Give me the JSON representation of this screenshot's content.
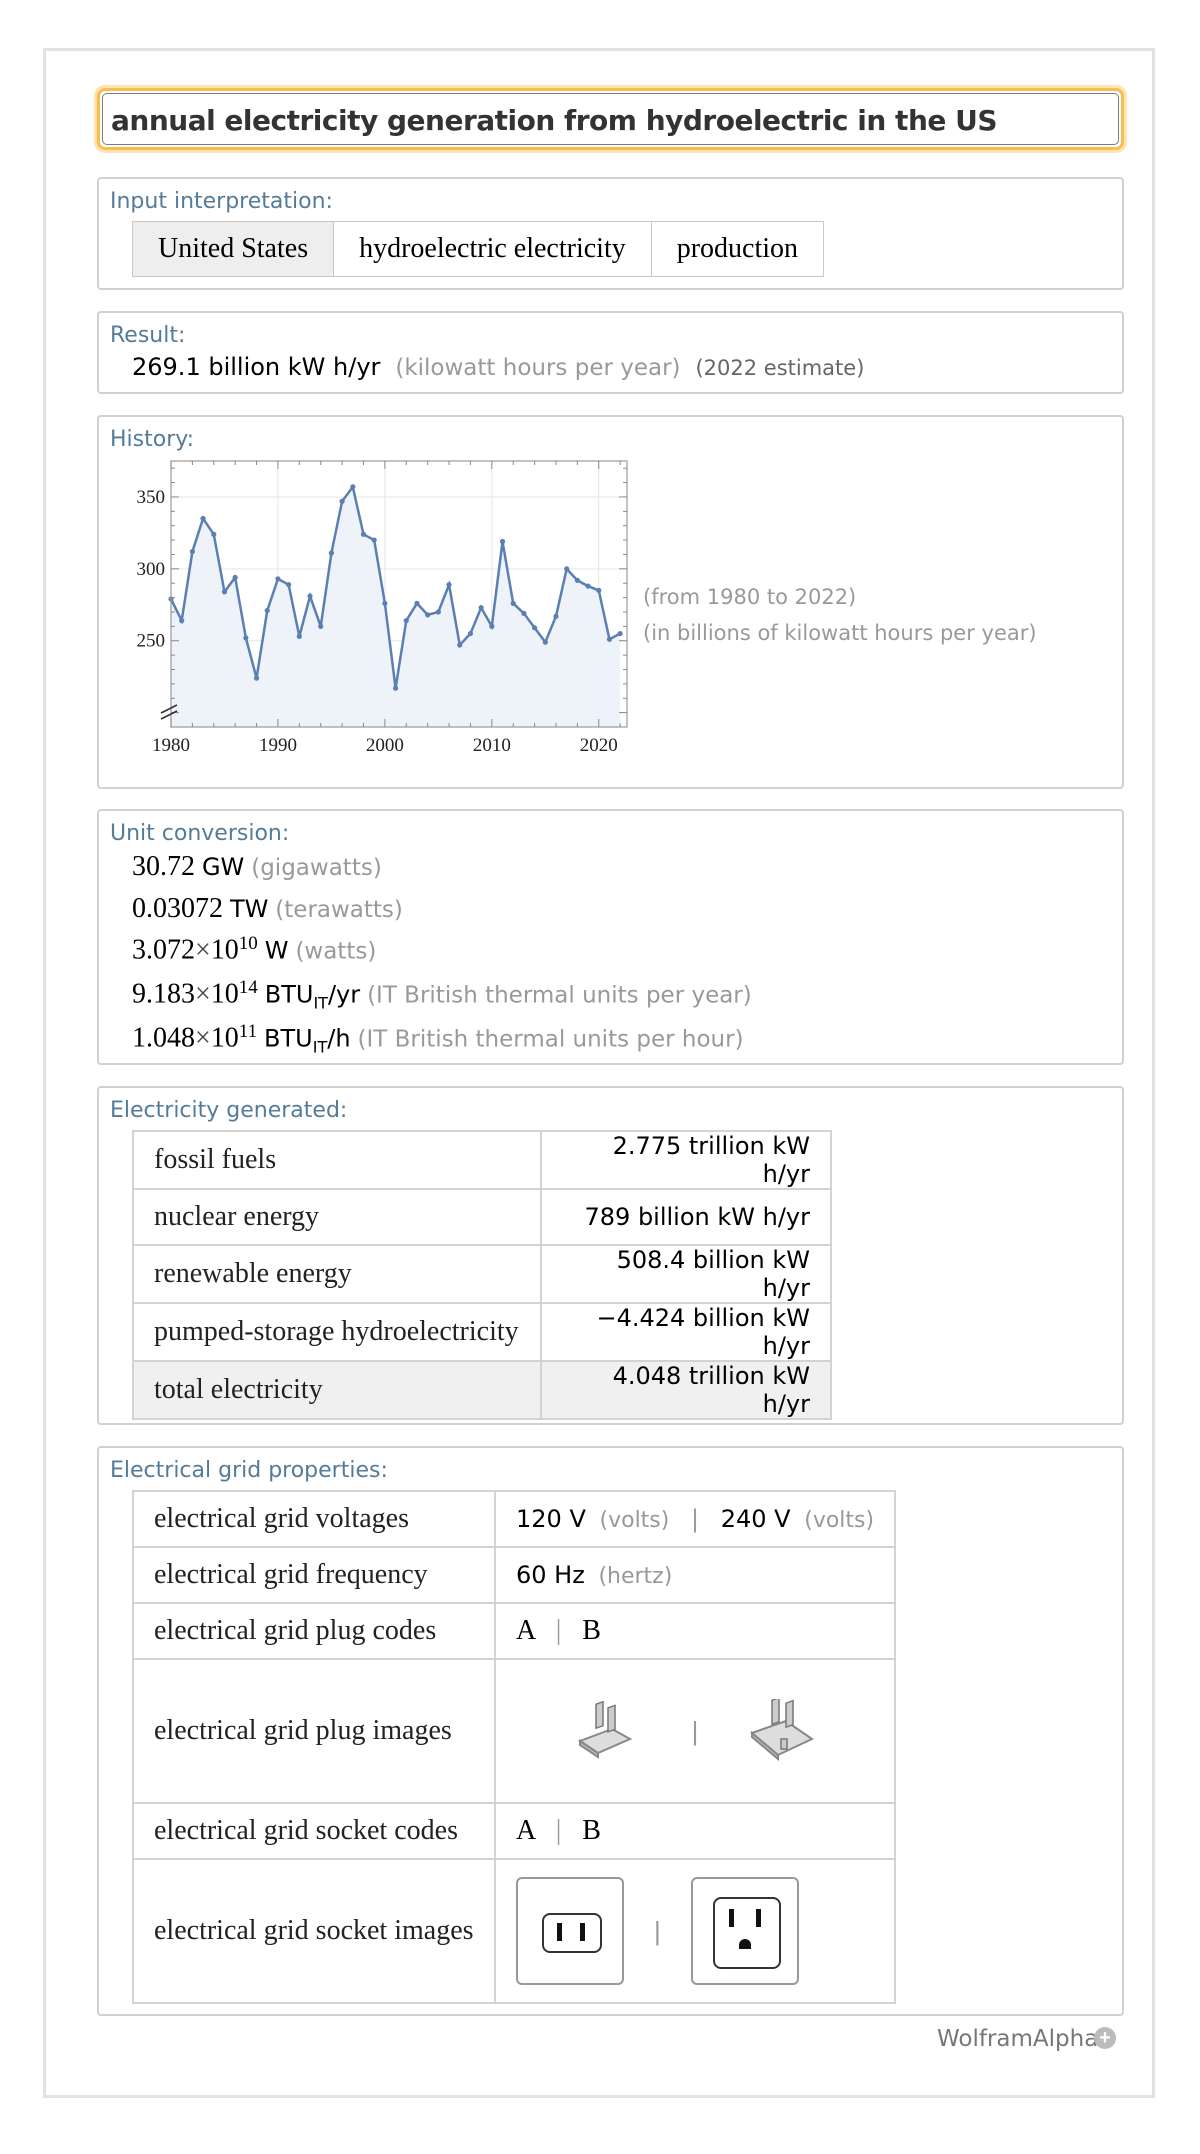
{
  "query": "annual electricity generation from hydroelectric in the US",
  "input": {
    "title": "Input interpretation:",
    "parts": [
      "United States",
      "hydroelectric electricity",
      "production"
    ]
  },
  "result": {
    "title": "Result:",
    "value": "269.1 billion kW h/yr",
    "desc": "(kilowatt hours per year)",
    "note": "(2022 estimate)"
  },
  "history": {
    "title": "History:",
    "range_note": "(from 1980 to 2022)",
    "units_note": "(in billions of kilowatt hours per year)"
  },
  "chart_data": {
    "type": "line",
    "x": [
      1980,
      1981,
      1982,
      1983,
      1984,
      1985,
      1986,
      1987,
      1988,
      1989,
      1990,
      1991,
      1992,
      1993,
      1994,
      1995,
      1996,
      1997,
      1998,
      1999,
      2000,
      2001,
      2002,
      2003,
      2004,
      2005,
      2006,
      2007,
      2008,
      2009,
      2010,
      2011,
      2012,
      2013,
      2014,
      2015,
      2016,
      2017,
      2018,
      2019,
      2020,
      2021,
      2022
    ],
    "values": [
      279,
      264,
      312,
      335,
      324,
      284,
      294,
      252,
      224,
      271,
      293,
      289,
      253,
      281,
      260,
      311,
      347,
      357,
      324,
      320,
      276,
      217,
      264,
      276,
      268,
      270,
      289,
      247,
      255,
      273,
      260,
      319,
      276,
      269,
      259,
      249,
      267,
      300,
      292,
      288,
      285,
      251,
      255
    ],
    "xticks": [
      "1980",
      "1990",
      "2000",
      "2010",
      "2020"
    ],
    "yticks": [
      "250",
      "300",
      "350"
    ],
    "xlim": [
      1980,
      2022
    ],
    "ylim": [
      190,
      375
    ],
    "grid": true,
    "color": "#5b7fb3"
  },
  "conversion": {
    "title": "Unit conversion:",
    "rows": [
      {
        "mant": "30.72",
        "unit": "GW",
        "desc": "(gigawatts)"
      },
      {
        "mant": "0.03072",
        "unit": "TW",
        "desc": "(terawatts)"
      },
      {
        "mant": "3.072",
        "times": "×",
        "base": "10",
        "exp": "10",
        "unit": "W",
        "desc": "(watts)"
      },
      {
        "mant": "9.183",
        "times": "×",
        "base": "10",
        "exp": "14",
        "unit": "BTU",
        "sub": "IT",
        "unit2": "/yr",
        "desc": "(IT British thermal units per year)"
      },
      {
        "mant": "1.048",
        "times": "×",
        "base": "10",
        "exp": "11",
        "unit": "BTU",
        "sub": "IT",
        "unit2": "/h",
        "desc": "(IT British thermal units per hour)"
      }
    ]
  },
  "generated": {
    "title": "Electricity generated:",
    "rows": [
      {
        "label": "fossil fuels",
        "value": "2.775 trillion kW h/yr"
      },
      {
        "label": "nuclear energy",
        "value": "789 billion kW h/yr"
      },
      {
        "label": "renewable energy",
        "value": "508.4 billion kW h/yr"
      },
      {
        "label": "pumped-storage hydroelectricity",
        "value": "−4.424 billion kW h/yr"
      },
      {
        "label": "total electricity",
        "value": "4.048 trillion kW h/yr"
      }
    ]
  },
  "grid": {
    "title": "Electrical grid properties:",
    "voltages_label": "electrical grid voltages",
    "voltage1": "120 V",
    "voltage1_desc": "(volts)",
    "voltage2": "240 V",
    "voltage2_desc": "(volts)",
    "frequency_label": "electrical grid frequency",
    "frequency": "60 Hz",
    "frequency_desc": "(hertz)",
    "plug_codes_label": "electrical grid plug codes",
    "plug_code1": "A",
    "plug_code2": "B",
    "plug_images_label": "electrical grid plug images",
    "socket_codes_label": "electrical grid socket codes",
    "socket_code1": "A",
    "socket_code2": "B",
    "socket_images_label": "electrical grid socket images",
    "separator": "|"
  },
  "footer": {
    "brand": "WolframAlpha",
    "icon": "plus-circle-icon"
  }
}
